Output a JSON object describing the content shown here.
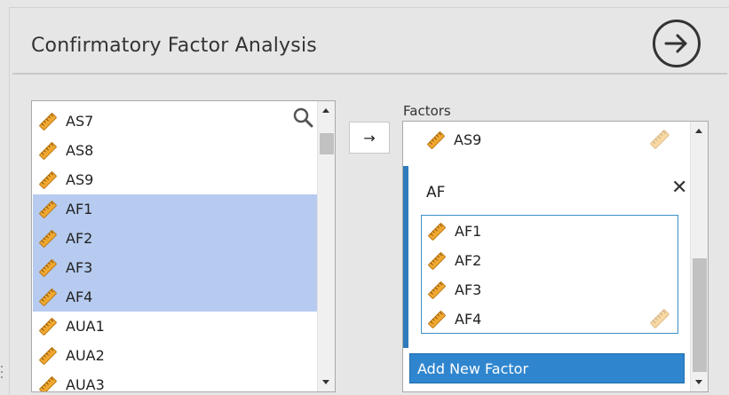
{
  "header": {
    "title": "Confirmatory Factor Analysis"
  },
  "source_list": {
    "items": [
      {
        "label": "AS7",
        "selected": false
      },
      {
        "label": "AS8",
        "selected": false
      },
      {
        "label": "AS9",
        "selected": false
      },
      {
        "label": "AF1",
        "selected": true
      },
      {
        "label": "AF2",
        "selected": true
      },
      {
        "label": "AF3",
        "selected": true
      },
      {
        "label": "AF4",
        "selected": true
      },
      {
        "label": "AUA1",
        "selected": false
      },
      {
        "label": "AUA2",
        "selected": false
      },
      {
        "label": "AUA3",
        "selected": false
      }
    ]
  },
  "move_button": {
    "label": "→"
  },
  "factors": {
    "label": "Factors",
    "previous_item": "AS9",
    "current_factor": {
      "name": "AF",
      "items": [
        "AF1",
        "AF2",
        "AF3",
        "AF4"
      ]
    },
    "add_button": "Add New Factor"
  },
  "icons": {
    "variable": "ruler-icon",
    "search": "search-icon",
    "go": "arrow-circle-right-icon",
    "remove": "close-icon"
  },
  "colors": {
    "selection": "#b6cbef",
    "accent": "#2f7bbd",
    "button": "#2f86cf",
    "ruler": "#f0a830"
  }
}
